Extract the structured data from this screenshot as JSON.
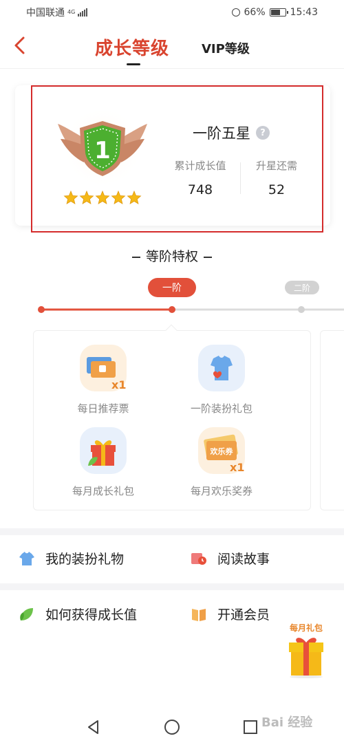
{
  "status_bar": {
    "carrier": "中国联通",
    "network": "4G",
    "battery": "66%",
    "battery_level": 0.66,
    "time": "15:43"
  },
  "header": {
    "tab_growth": "成长等级",
    "tab_vip": "VIP等级"
  },
  "level_card": {
    "badge_number": "1",
    "stars": 5,
    "level_name": "一阶五星",
    "help_glyph": "?",
    "stats": [
      {
        "label": "累计成长值",
        "value": "748"
      },
      {
        "label": "升星还需",
        "value": "52"
      }
    ]
  },
  "privileges": {
    "title": "等阶特权",
    "stages": [
      {
        "label": "一阶",
        "active": true
      },
      {
        "label": "二阶",
        "active": false
      }
    ],
    "items": [
      {
        "label": "每日推荐票",
        "icon": "ticket-icon",
        "bg": "#fdf0df"
      },
      {
        "label": "一阶装扮礼包",
        "icon": "shirt-icon",
        "bg": "#e8f0fb"
      },
      {
        "label": "每月成长礼包",
        "icon": "gift-icon",
        "bg": "#e8f0fb"
      },
      {
        "label": "每月欢乐奖券",
        "icon": "coupon-icon",
        "bg": "#fdf0df"
      }
    ],
    "ticket_multiplier": "x1",
    "coupon_multiplier": "x1",
    "coupon_text": "欢乐券"
  },
  "menu": {
    "my_outfit": "我的装扮礼物",
    "read_story": "阅读故事",
    "how_to_grow": "如何获得成长值",
    "open_member": "开通会员"
  },
  "floating_gift": {
    "label": "每月礼包"
  },
  "watermark": "Bai 经验",
  "colors": {
    "accent": "#d9442f",
    "highlight_border": "#d42b2b",
    "badge_green": "#4caf30",
    "star_gold": "#f5b918"
  }
}
